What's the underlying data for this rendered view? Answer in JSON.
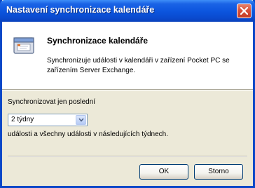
{
  "window": {
    "title": "Nastavení synchronizace kalendáře",
    "title_color": "#ffffff",
    "accent": "#0a49cd"
  },
  "header": {
    "title": "Synchronizace kalendáře",
    "description": "Synchronizuje události v kalendáři v zařízení Pocket PC se zařízením Server Exchange.",
    "icon": "calendar-sync-icon"
  },
  "sync": {
    "label": "Synchronizovat jen poslední",
    "selected": "2 týdny",
    "after_text": "události a všechny události v následujících týdnech."
  },
  "buttons": {
    "ok": "OK",
    "cancel": "Storno"
  },
  "icons": {
    "close": "close-icon",
    "dropdown": "chevron-down-icon"
  }
}
